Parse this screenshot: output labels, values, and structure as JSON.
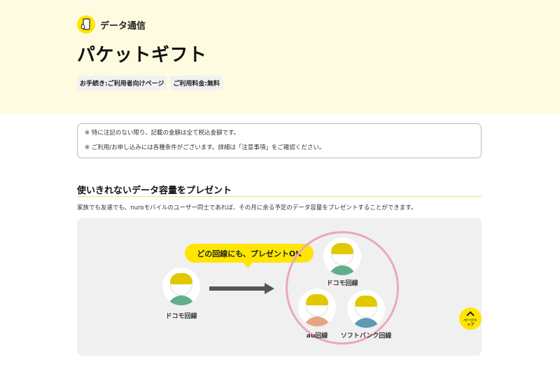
{
  "header": {
    "category": "データ通信",
    "title": "パケットギフト",
    "tags": [
      "お手続き:ご利用者向けページ",
      "ご利用料金:無料"
    ]
  },
  "notice": {
    "line1": "※ 特に注記のない限り、記載の金額は全て税込金額です。",
    "line2": "※ ご利用/お申し込みには各種条件がございます。詳細は「注意事項」をご確認ください。"
  },
  "section": {
    "title": "使いきれないデータ容量をプレゼント",
    "description": "家族でも友達でも、nuroモバイルのユーザー同士であれば、その月に余る予定のデータ容量をプレゼントすることができます。"
  },
  "illustration": {
    "bubble": "どの回線にも、プレゼントOK",
    "sender_label": "ドコモ回線",
    "recipients": {
      "docomo": "ドコモ回線",
      "au": "au回線",
      "softbank": "ソフトバンク回線"
    },
    "colors": {
      "bubble": "#ffe600",
      "ring": "#e8a8c0",
      "green": "#5fae8d",
      "orange": "#e8a583",
      "blue": "#5f99b3"
    }
  },
  "page_top": {
    "label": "ページトップ",
    "icon": "chevron-up-icon"
  }
}
